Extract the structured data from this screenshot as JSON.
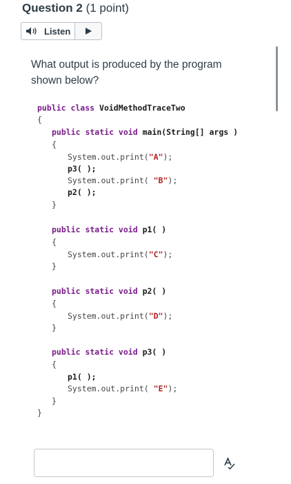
{
  "question": {
    "number_label": "Question 2",
    "points_label": "(1 point)"
  },
  "listen": {
    "label": "Listen"
  },
  "prompt": {
    "line1": "What output is produced by the program",
    "line2": "shown below?"
  },
  "code": {
    "class_decl": [
      "public class",
      "VoidMethodTraceTwo"
    ],
    "open_brace": "{",
    "close_brace": "}",
    "main_sig": [
      "public static void",
      "main(String[] args )"
    ],
    "main_body": [
      [
        "System.out.print(",
        "\"A\"",
        ");"
      ],
      [
        "p3( );"
      ],
      [
        "System.out.print( ",
        "\"B\"",
        ");"
      ],
      [
        "p2( );"
      ]
    ],
    "p1_sig": [
      "public static void",
      "p1( )"
    ],
    "p1_body": [
      "System.out.print(",
      "\"C\"",
      ");"
    ],
    "p2_sig": [
      "public static void",
      "p2( )"
    ],
    "p2_body": [
      "System.out.print(",
      "\"D\"",
      ");"
    ],
    "p3_sig": [
      "public static void",
      "p3( )"
    ],
    "p3_body": [
      [
        "p1( );"
      ],
      [
        "System.out.print( ",
        "\"E\"",
        ");"
      ]
    ]
  },
  "answer": {
    "value": ""
  },
  "colors": {
    "keyword": "#7a1d8a",
    "string": "#b22222"
  }
}
